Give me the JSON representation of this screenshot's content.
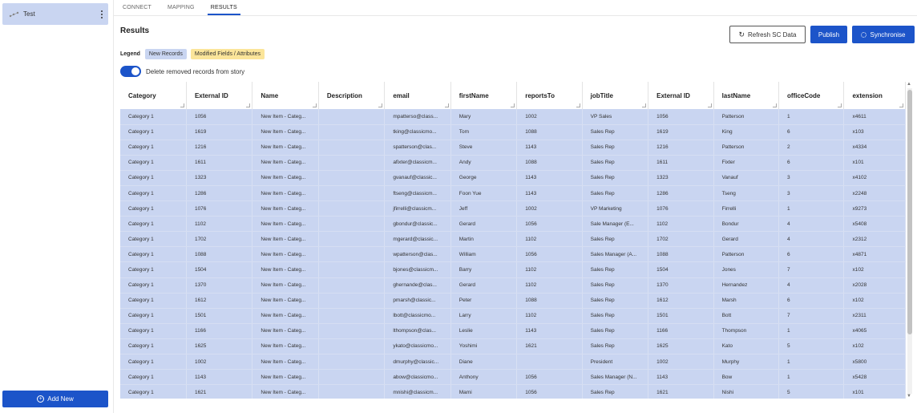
{
  "sidebar": {
    "item_label": "Test",
    "add_new_label": "Add New"
  },
  "tabs": [
    "CONNECT",
    "MAPPING",
    "RESULTS"
  ],
  "results": {
    "title": "Results",
    "legend_label": "Legend",
    "legend_new": "New Records",
    "legend_modified": "Modified Fields / Attributes",
    "toggle_label": "Delete removed records from story"
  },
  "buttons": {
    "refresh": "Refresh SC Data",
    "publish": "Publish",
    "synchronise": "Synchronise"
  },
  "table": {
    "columns": [
      "Category",
      "External ID",
      "Name",
      "Description",
      "email",
      "firstName",
      "reportsTo",
      "jobTitle",
      "External ID",
      "lastName",
      "officeCode",
      "extension"
    ],
    "rows": [
      [
        "Category 1",
        "1056",
        "New Item - Categ...",
        "",
        "mpatterso@class...",
        "Mary",
        "1002",
        "VP Sales",
        "1056",
        "Patterson",
        "1",
        "x4611"
      ],
      [
        "Category 1",
        "1619",
        "New Item - Categ...",
        "",
        "tking@classicmo...",
        "Tom",
        "1088",
        "Sales Rep",
        "1619",
        "King",
        "6",
        "x103"
      ],
      [
        "Category 1",
        "1216",
        "New Item - Categ...",
        "",
        "spatterson@clas...",
        "Steve",
        "1143",
        "Sales Rep",
        "1216",
        "Patterson",
        "2",
        "x4334"
      ],
      [
        "Category 1",
        "1611",
        "New Item - Categ...",
        "",
        "afixter@classicm...",
        "Andy",
        "1088",
        "Sales Rep",
        "1611",
        "Fixter",
        "6",
        "x101"
      ],
      [
        "Category 1",
        "1323",
        "New Item - Categ...",
        "",
        "gvanauf@classic...",
        "George",
        "1143",
        "Sales Rep",
        "1323",
        "Vanauf",
        "3",
        "x4102"
      ],
      [
        "Category 1",
        "1286",
        "New Item - Categ...",
        "",
        "ftseng@classicm...",
        "Foon Yue",
        "1143",
        "Sales Rep",
        "1286",
        "Tseng",
        "3",
        "x2248"
      ],
      [
        "Category 1",
        "1076",
        "New Item - Categ...",
        "",
        "jfirrelli@classicm...",
        "Jeff",
        "1002",
        "VP Marketing",
        "1076",
        "Firrelli",
        "1",
        "x9273"
      ],
      [
        "Category 1",
        "1102",
        "New Item - Categ...",
        "",
        "gbondur@classic...",
        "Gerard",
        "1056",
        "Sale Manager (E...",
        "1102",
        "Bondur",
        "4",
        "x5408"
      ],
      [
        "Category 1",
        "1702",
        "New Item - Categ...",
        "",
        "mgerard@classic...",
        "Martin",
        "1102",
        "Sales Rep",
        "1702",
        "Gerard",
        "4",
        "x2312"
      ],
      [
        "Category 1",
        "1088",
        "New Item - Categ...",
        "",
        "wpatterson@clas...",
        "William",
        "1056",
        "Sales Manager (A...",
        "1088",
        "Patterson",
        "6",
        "x4871"
      ],
      [
        "Category 1",
        "1504",
        "New Item - Categ...",
        "",
        "bjones@classicm...",
        "Barry",
        "1102",
        "Sales Rep",
        "1504",
        "Jones",
        "7",
        "x102"
      ],
      [
        "Category 1",
        "1370",
        "New Item - Categ...",
        "",
        "ghernande@clas...",
        "Gerard",
        "1102",
        "Sales Rep",
        "1370",
        "Hernandez",
        "4",
        "x2028"
      ],
      [
        "Category 1",
        "1612",
        "New Item - Categ...",
        "",
        "pmarsh@classic...",
        "Peter",
        "1088",
        "Sales Rep",
        "1612",
        "Marsh",
        "6",
        "x102"
      ],
      [
        "Category 1",
        "1501",
        "New Item - Categ...",
        "",
        "lbott@classicmo...",
        "Larry",
        "1102",
        "Sales Rep",
        "1501",
        "Bott",
        "7",
        "x2311"
      ],
      [
        "Category 1",
        "1166",
        "New Item - Categ...",
        "",
        "lthompson@clas...",
        "Leslie",
        "1143",
        "Sales Rep",
        "1166",
        "Thompson",
        "1",
        "x4065"
      ],
      [
        "Category 1",
        "1625",
        "New Item - Categ...",
        "",
        "ykato@classicmo...",
        "Yoshimi",
        "1621",
        "Sales Rep",
        "1625",
        "Kato",
        "5",
        "x102"
      ],
      [
        "Category 1",
        "1002",
        "New Item - Categ...",
        "",
        "dmurphy@classic...",
        "Diane",
        "",
        "President",
        "1002",
        "Murphy",
        "1",
        "x5800"
      ],
      [
        "Category 1",
        "1143",
        "New Item - Categ...",
        "",
        "abow@classicmo...",
        "Anthony",
        "1056",
        "Sales Manager (N...",
        "1143",
        "Bow",
        "1",
        "x5428"
      ],
      [
        "Category 1",
        "1621",
        "New Item - Categ...",
        "",
        "mnishi@classicm...",
        "Mami",
        "1056",
        "Sales Rep",
        "1621",
        "Nishi",
        "5",
        "x101"
      ]
    ]
  },
  "colors": {
    "accent": "#1c54c9",
    "new_record": "#c9d5f1",
    "modified": "#fbe59a"
  }
}
